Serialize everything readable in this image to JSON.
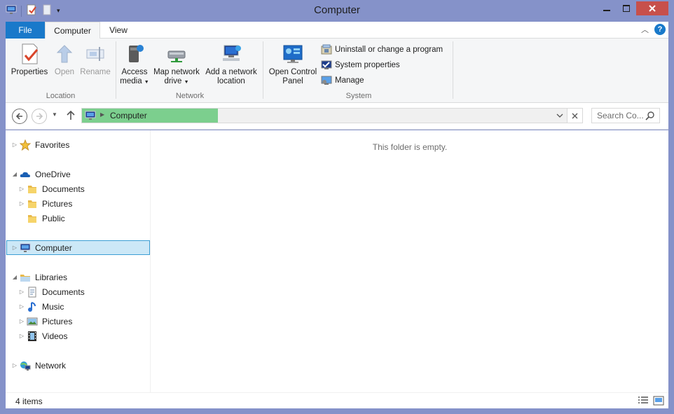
{
  "window": {
    "title": "Computer"
  },
  "ribbon_tabs": {
    "file": "File",
    "computer": "Computer",
    "view": "View"
  },
  "ribbon": {
    "location": {
      "label": "Location",
      "properties": "Properties",
      "open": "Open",
      "rename": "Rename"
    },
    "network": {
      "label": "Network",
      "access_media_1": "Access",
      "access_media_2": "media",
      "map_drive_1": "Map network",
      "map_drive_2": "drive",
      "add_location_1": "Add a network",
      "add_location_2": "location"
    },
    "system": {
      "label": "System",
      "control_panel_1": "Open Control",
      "control_panel_2": "Panel",
      "uninstall": "Uninstall or change a program",
      "system_properties": "System properties",
      "manage": "Manage"
    }
  },
  "address": {
    "path": "Computer",
    "search_placeholder": "Search Co..."
  },
  "nav_tree": {
    "favorites": "Favorites",
    "onedrive": "OneDrive",
    "onedrive_documents": "Documents",
    "onedrive_pictures": "Pictures",
    "onedrive_public": "Public",
    "computer": "Computer",
    "libraries": "Libraries",
    "lib_documents": "Documents",
    "lib_music": "Music",
    "lib_pictures": "Pictures",
    "lib_videos": "Videos",
    "network": "Network"
  },
  "content": {
    "empty_message": "This folder is empty."
  },
  "status": {
    "items": "4 items"
  },
  "colors": {
    "accent": "#1979ca",
    "titlebar": "#8592c9",
    "address_progress": "#7ccf8e",
    "close": "#c7504b",
    "selection": "#cce8f7"
  }
}
